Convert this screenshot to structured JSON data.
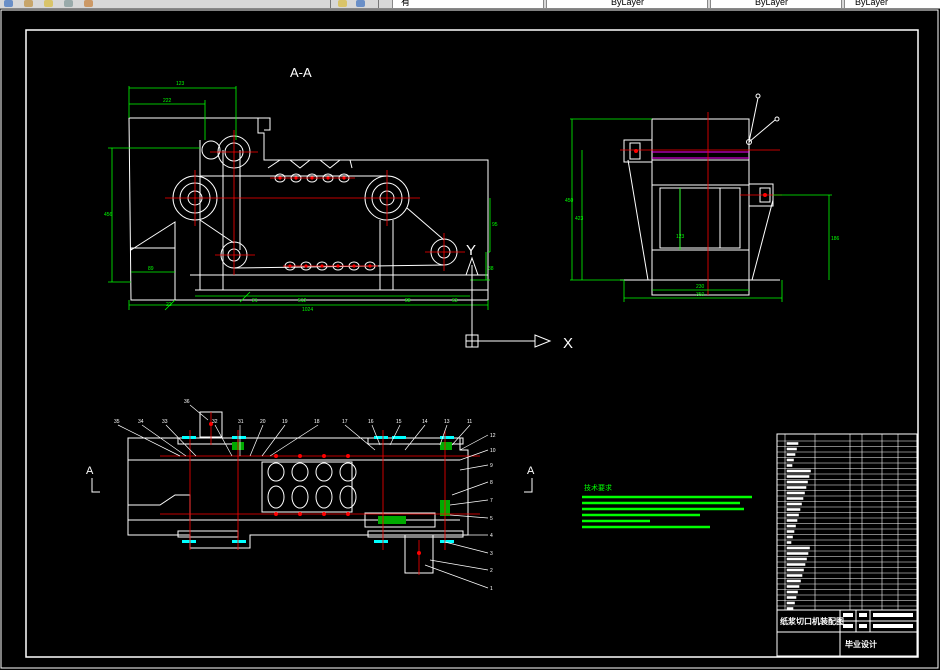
{
  "toolbar": {
    "icons": [
      "layer-icon",
      "save-icon",
      "folder-icon",
      "print-icon",
      "properties-icon"
    ],
    "fields": [
      "ByLayer",
      "ByLayer",
      "ByLayer"
    ],
    "layer_state_label": "有"
  },
  "drawing": {
    "section_title": "A-A",
    "axis_x_label": "X",
    "axis_y_label": "Y",
    "section_mark_left": "A",
    "section_mark_right": "A",
    "tech_req_title": "技术要求",
    "title_block_name": "纸浆切口机装配图",
    "title_block_school": "毕业设计"
  },
  "colors": {
    "background": "#000000",
    "outline": "#ffffff",
    "dimension": "#00ff00",
    "centerline": "#ff0000",
    "cyan": "#00ffff",
    "magenta": "#ff00ff",
    "yellow": "#ffff00"
  }
}
